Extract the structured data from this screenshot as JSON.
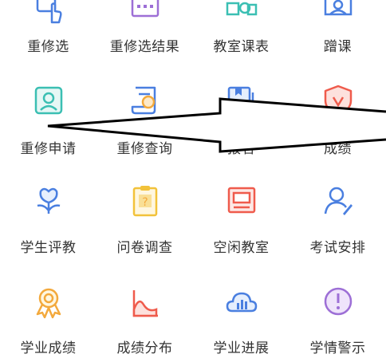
{
  "grid": {
    "row1": [
      {
        "label": "重修选",
        "icon": "touch-select-icon"
      },
      {
        "label": "重修选结果",
        "icon": "calendar-grid-icon"
      },
      {
        "label": "教室课表",
        "icon": "classroom-schedule-icon"
      },
      {
        "label": "蹭课",
        "icon": "audit-class-icon"
      }
    ],
    "row2": [
      {
        "label": "重修申请",
        "icon": "id-card-icon"
      },
      {
        "label": "重修查询",
        "icon": "scroll-search-icon"
      },
      {
        "label": "报名",
        "icon": "registration-book-icon"
      },
      {
        "label": "成绩",
        "icon": "shield-check-icon"
      }
    ],
    "row3": [
      {
        "label": "学生评教",
        "icon": "flower-evaluate-icon"
      },
      {
        "label": "问卷调查",
        "icon": "questionnaire-clipboard-icon"
      },
      {
        "label": "空闲教室",
        "icon": "empty-classroom-icon"
      },
      {
        "label": "考试安排",
        "icon": "exam-person-pen-icon"
      }
    ],
    "row4": [
      {
        "label": "学业成绩",
        "icon": "award-medal-icon"
      },
      {
        "label": "成绩分布",
        "icon": "distribution-chart-icon"
      },
      {
        "label": "学业进展",
        "icon": "progress-cloud-chart-icon"
      },
      {
        "label": "学情警示",
        "icon": "warning-circle-icon"
      }
    ]
  },
  "colors": {
    "teal": "#3bbfb3",
    "purple": "#9d6fd6",
    "blue": "#4a7fe0",
    "red": "#ef5b4c",
    "orange": "#f3a93c",
    "yellow": "#f2c23a",
    "text": "#333333"
  }
}
